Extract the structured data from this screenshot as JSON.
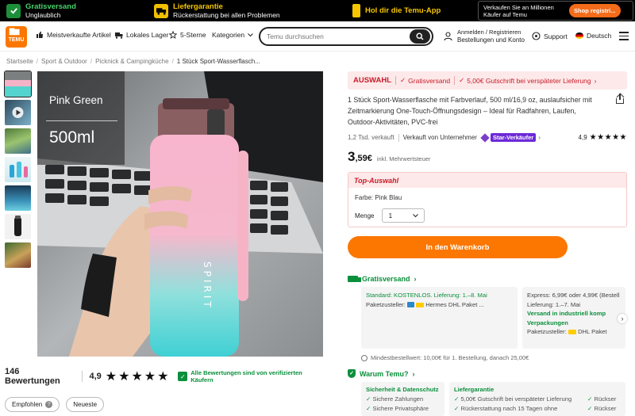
{
  "promo": {
    "shipping_title": "Gratisversand",
    "shipping_sub": "Unglaublich",
    "guarantee_title": "Liefergarantie",
    "guarantee_sub": "Rückerstattung bei allen Problemen",
    "app_label": "Hol dir die Temu-App",
    "seller_text": "Verkaufen Sie an Millionen Käufer auf Temu",
    "seller_button": "Shop registri..."
  },
  "header": {
    "logo_top": "▇▆",
    "logo_text": "TEMU",
    "nav": [
      "Meistverkaufte Artikel",
      "Lokales Lager",
      "5-Sterne",
      "Kategorien"
    ],
    "search_placeholder": "Temu durchsuchen",
    "account_line1": "Anmelden / Registrieren",
    "account_line2": "Bestellungen und Konto",
    "support": "Support",
    "language": "Deutsch"
  },
  "breadcrumb": [
    "Startseite",
    "Sport & Outdoor",
    "Picknick & Campingküche",
    "1 Stück Sport-Wasserflasch..."
  ],
  "product": {
    "image_label_color": "Pink Green",
    "image_label_size": "500ml",
    "bottle_text": "SPIRIT",
    "deal_label": "AUSWAHL",
    "deal_free": "Gratisversand",
    "deal_credit": "5,00€ Gutschrift bei verspäteter Lieferung",
    "title": "1 Stück Sport-Wasserflasche mit Farbverlauf, 500 ml/16,9 oz, auslaufsicher mit Zeitmarkierung One-Touch-Öffnungsdesign – Ideal für Radfahren, Laufen, Outdoor-Aktivitäten, PVC-frei",
    "sold": "1,2 Tsd. verkauft",
    "seller": "Verkauft von Unternehmer",
    "star_badge": "Star-Verkäufer",
    "rating": "4,9",
    "stars": "★★★★★",
    "price_main": "3",
    "price_cents": ",59€",
    "tax_note": "inkl. Mehrwertsteuer",
    "top_label": "Top-Auswahl",
    "color_line": "Farbe: Pink Blau",
    "qty_label": "Menge",
    "qty_value": "1",
    "cart_button": "In den Warenkorb"
  },
  "reviews": {
    "count": "146 Bewertungen",
    "score": "4,9",
    "stars": "★★★★★",
    "verified": "Alle Bewertungen sind von verifizierten Käufern",
    "filter_recommended": "Empfohlen",
    "filter_recent": "Neueste"
  },
  "shipping": {
    "heading": "Gratisversand",
    "card1_line1": "Standard: KOSTENLOS. Lieferung: 1.–8. Mai",
    "card1_line2": "Paketzusteller:",
    "card1_carriers": "Hermes  DHL Paket ...",
    "card2_line1": "Express: 6,99€ oder 4,99€ (Bestell",
    "card2_line2": "Lieferung: 1.–7. Mai",
    "card2_line3": "Versand in industriell komp Verpackungen",
    "card2_line4": "Paketzusteller:",
    "card2_carrier": "DHL Paket",
    "min_order": "Mindestbestellwert: 10,00€ für 1. Bestellung, danach 25,00€"
  },
  "why": {
    "heading": "Warum Temu?",
    "col1_title": "Sicherheit & Datenschutz",
    "col1_items": [
      "Sichere Zahlungen",
      "Sichere Privatsphäre"
    ],
    "col2_title": "Liefergarantie",
    "col2_items": [
      "5,00€ Gutschrift bei verspäteter Lieferung",
      "Rückerstattung nach 15 Tagen ohne"
    ],
    "col3_items": [
      "Rückser",
      "Rückser"
    ]
  },
  "colors": {
    "brand": "#fb7701",
    "deal_red": "#c81b2a",
    "green": "#0a8f3b",
    "promo_yellow": "#f7c600"
  }
}
